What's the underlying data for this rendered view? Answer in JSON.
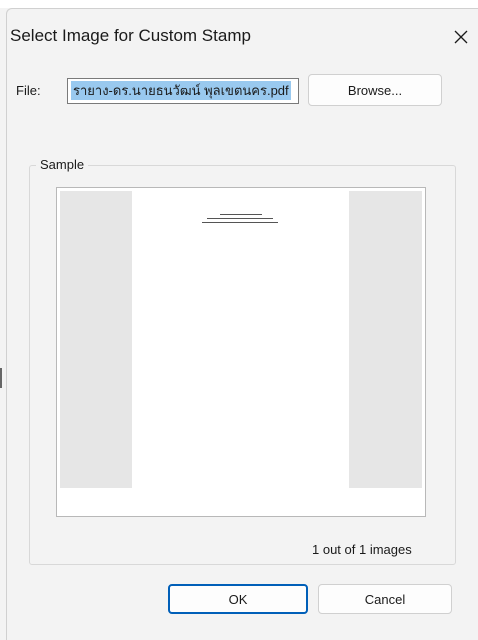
{
  "dialog": {
    "title": "Select Image for Custom Stamp",
    "close_icon": "close-icon"
  },
  "file": {
    "label": "File:",
    "value": "รายาง-ดร.นายธนวัฒน์ พุลเขตนคร.pdf",
    "browse_label": "Browse..."
  },
  "sample": {
    "group_label": "Sample",
    "counter": "1 out of 1 images"
  },
  "buttons": {
    "ok_label": "OK",
    "cancel_label": "Cancel"
  },
  "colors": {
    "accent": "#005fb8",
    "selection": "#99c9ef",
    "background": "#f3f3f3",
    "preview_gray": "#e6e6e6"
  }
}
